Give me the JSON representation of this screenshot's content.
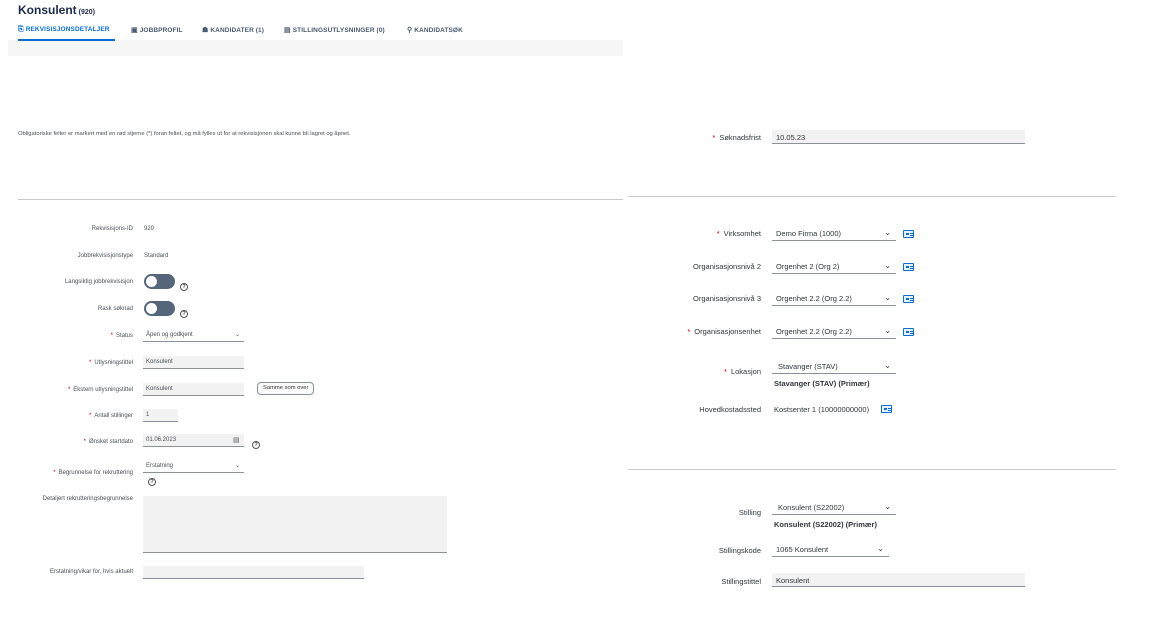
{
  "header": {
    "title": "Konsulent",
    "count": "(920)",
    "tabs": [
      {
        "icon": "⎘",
        "label": "REKVISISJONSDETALJER"
      },
      {
        "icon": "▣",
        "label": "JOBBPROFIL"
      },
      {
        "icon": "☗",
        "label": "KANDIDATER (1)"
      },
      {
        "icon": "▤",
        "label": "STILLINGSUTLYSNINGER (0)"
      },
      {
        "icon": "⚲",
        "label": "KANDIDATSØK"
      }
    ]
  },
  "info_text": "Obligatoriske felter er markert med en rød stjerne (*) foran feltet, og må fylles ut for at rekvisisjonen skal kunne bli lagret og åpnet.",
  "left_form": {
    "req_id_label": "Rekvisisjons-ID",
    "req_id_value": "920",
    "type_label": "Jobbrekvisisjonstype",
    "type_value": "Standard",
    "longterm_label": "Langsiktig jobbrekvisisjon",
    "quick_label": "Rask søknad",
    "status_label": "Status",
    "status_value": "Åpen og godkjent",
    "posting_title_label": "Utlysningstittel",
    "posting_title_value": "Konsulent",
    "external_title_label": "Ekstern utlysningstittel",
    "external_title_value": "Konsulent",
    "same_as_above_label": "Samme som over",
    "positions_label": "Antall stillinger",
    "positions_value": "1",
    "start_date_label": "Ønsket startdato",
    "start_date_value": "01.06.2023",
    "reason_label": "Begrunnelse for rekruttering",
    "reason_value": "Erstatning",
    "detailed_reason_label": "Detaljert rekrutteringsbegrunnelse",
    "replacement_label": "Erstatning/vikar for, hvis aktuelt",
    "replacement_value": ""
  },
  "right_form": {
    "deadline_label": "Søknadsfrist",
    "deadline_value": "10.05.23",
    "company_label": "Virksomhet",
    "company_value": "Demo Firma (1000)",
    "org2_label": "Organisasjonsnivå 2",
    "org2_value": "Orgenhet 2 (Org 2)",
    "org3_label": "Organisasjonsnivå 3",
    "org3_value": "Orgenhet 2.2 (Org 2.2)",
    "orgunit_label": "Organisasjonsenhet",
    "orgunit_value": "Orgenhet 2.2 (Org 2.2)",
    "location_label": "Lokasjon",
    "location_value": "Stavanger (STAV)",
    "location_primary": "Stavanger (STAV) (Primær)",
    "costcenter_label": "Hovedkostadssted",
    "costcenter_value": "Kostsenter 1 (10000000000)",
    "position_label": "Stilling",
    "position_value": "Konsulent (S22002)",
    "position_primary": "Konsulent (S22002) (Primær)",
    "position_code_label": "Stillingskode",
    "position_code_value": "1065 Konsulent",
    "position_title_label": "Stillingstittel",
    "position_title_value": "Konsulent"
  },
  "colors": {
    "accent": "#0a6ed1",
    "required": "#bb0000",
    "toggle_off": "#55657a"
  }
}
